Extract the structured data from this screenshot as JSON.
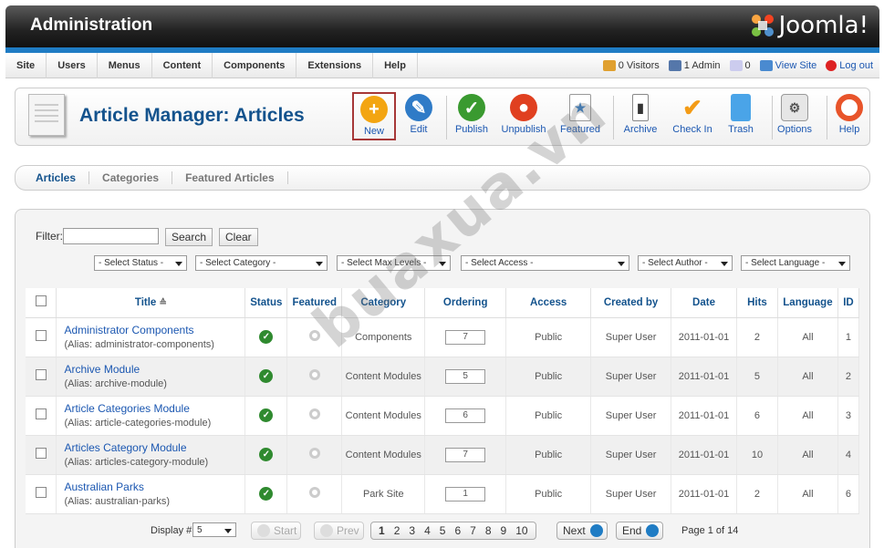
{
  "header": {
    "title": "Administration",
    "logo_text": "Joomla!"
  },
  "menu": [
    "Site",
    "Users",
    "Menus",
    "Content",
    "Components",
    "Extensions",
    "Help"
  ],
  "status": {
    "visitors": "0 Visitors",
    "admins": "1 Admin",
    "messages": "0",
    "view_site": "View Site",
    "logout": "Log out"
  },
  "page": {
    "title": "Article Manager: Articles"
  },
  "toolbar": {
    "new": "New",
    "edit": "Edit",
    "publish": "Publish",
    "unpublish": "Unpublish",
    "featured": "Featured",
    "archive": "Archive",
    "checkin": "Check In",
    "trash": "Trash",
    "options": "Options",
    "help": "Help"
  },
  "tabs": [
    "Articles",
    "Categories",
    "Featured Articles"
  ],
  "filter": {
    "label": "Filter:",
    "search": "Search",
    "clear": "Clear"
  },
  "selects": [
    "- Select Status -",
    "- Select Category -",
    "- Select Max Levels -",
    "- Select Access -",
    "- Select Author -",
    "- Select Language -"
  ],
  "columns": {
    "title": "Title",
    "status": "Status",
    "featured": "Featured",
    "category": "Category",
    "ordering": "Ordering",
    "access": "Access",
    "created_by": "Created by",
    "date": "Date",
    "hits": "Hits",
    "language": "Language",
    "id": "ID"
  },
  "rows": [
    {
      "title": "Administrator Components",
      "alias": "(Alias: administrator-components)",
      "category": "Components",
      "ordering": "7",
      "access": "Public",
      "created_by": "Super User",
      "date": "2011-01-01",
      "hits": "2",
      "language": "All",
      "id": "1"
    },
    {
      "title": "Archive Module",
      "alias": "(Alias: archive-module)",
      "category": "Content Modules",
      "ordering": "5",
      "access": "Public",
      "created_by": "Super User",
      "date": "2011-01-01",
      "hits": "5",
      "language": "All",
      "id": "2"
    },
    {
      "title": "Article Categories Module",
      "alias": "(Alias: article-categories-module)",
      "category": "Content Modules",
      "ordering": "6",
      "access": "Public",
      "created_by": "Super User",
      "date": "2011-01-01",
      "hits": "6",
      "language": "All",
      "id": "3"
    },
    {
      "title": "Articles Category Module",
      "alias": "(Alias: articles-category-module)",
      "category": "Content Modules",
      "ordering": "7",
      "access": "Public",
      "created_by": "Super User",
      "date": "2011-01-01",
      "hits": "10",
      "language": "All",
      "id": "4"
    },
    {
      "title": "Australian Parks",
      "alias": "(Alias: australian-parks)",
      "category": "Park Site",
      "ordering": "1",
      "access": "Public",
      "created_by": "Super User",
      "date": "2011-01-01",
      "hits": "2",
      "language": "All",
      "id": "6"
    }
  ],
  "pager": {
    "display_label": "Display #",
    "display_value": "5",
    "start": "Start",
    "prev": "Prev",
    "pages": [
      "1",
      "2",
      "3",
      "4",
      "5",
      "6",
      "7",
      "8",
      "9",
      "10"
    ],
    "next": "Next",
    "end": "End",
    "page_of": "Page 1 of 14"
  },
  "watermark": "buaxua.vn",
  "colors": {
    "header": "#222222",
    "accent_blue": "#1f7cc4",
    "title_blue": "#14538d",
    "publish_green": "#2f8a2f",
    "highlight_border": "#a63737"
  }
}
